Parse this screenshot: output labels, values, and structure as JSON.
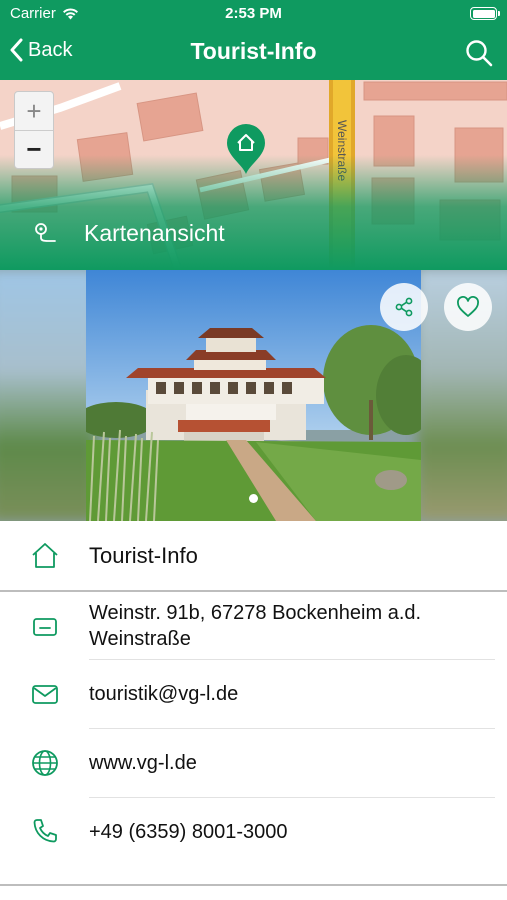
{
  "status_bar": {
    "carrier": "Carrier",
    "time": "2:53 PM"
  },
  "nav": {
    "back_label": "Back",
    "title": "Tourist-Info"
  },
  "map": {
    "street_label": "Weinstraße",
    "zoom_in": "+",
    "zoom_out": "−",
    "link_label": "Kartenansicht"
  },
  "gallery": {
    "page_count": 1,
    "current_page": 1
  },
  "details": {
    "name": "Tourist-Info",
    "address": "Weinstr. 91b, 67278 Bockenheim a.d. Weinstraße",
    "email": "touristik@vg-l.de",
    "website": "www.vg-l.de",
    "phone": "+49 (6359) 8001-3000"
  },
  "colors": {
    "brand_green": "#0f9a60",
    "map_background": "#f4d3c8",
    "map_road": "#f2c43a"
  },
  "icons": [
    "wifi-icon",
    "battery-icon",
    "back-chevron-icon",
    "search-icon",
    "home-pin-icon",
    "route-icon",
    "share-icon",
    "heart-icon",
    "home-icon",
    "address-card-icon",
    "mail-icon",
    "globe-icon",
    "phone-icon"
  ]
}
